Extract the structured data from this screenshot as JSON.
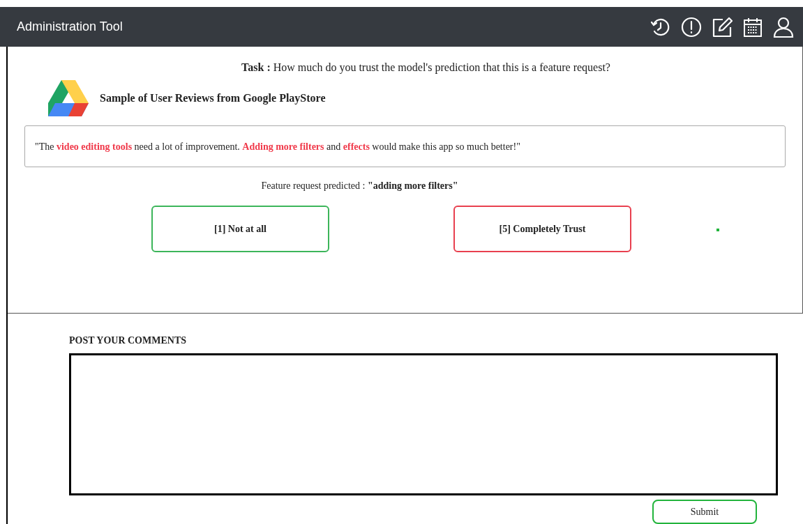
{
  "window": {
    "title": "Administration Tool"
  },
  "toolbar_icons": [
    {
      "kind": "history"
    },
    {
      "kind": "alert"
    },
    {
      "kind": "edit"
    },
    {
      "kind": "calendar"
    },
    {
      "kind": "user"
    }
  ],
  "task": "**Task :** How much do you trust the model's prediction that this is a feature request?",
  "source": {
    "title": "Sample of User Reviews from Google PlayStore"
  },
  "review": [
    {
      "text": "\"The ",
      "highlight": false
    },
    {
      "text": "video editing tools",
      "highlight": true
    },
    {
      "text": " need a lot of improvement. ",
      "highlight": false
    },
    {
      "text": "Adding more filters",
      "highlight": true
    },
    {
      "text": " and ",
      "highlight": false
    },
    {
      "text": "effects",
      "highlight": true
    },
    {
      "text": " would make this app so much better!\"",
      "highlight": false
    }
  ],
  "prediction": "Feature request predicted : **\"adding more filters\"**",
  "choices": [
    {
      "label": "[1] Not at all",
      "color": "#3cb55a"
    },
    {
      "label": "[5] Completely Trust",
      "color": "#e8404f"
    }
  ],
  "comments": {
    "heading": "POST YOUR COMMENTS"
  },
  "submit": {
    "label": "Submit",
    "color": "#22b43c"
  }
}
